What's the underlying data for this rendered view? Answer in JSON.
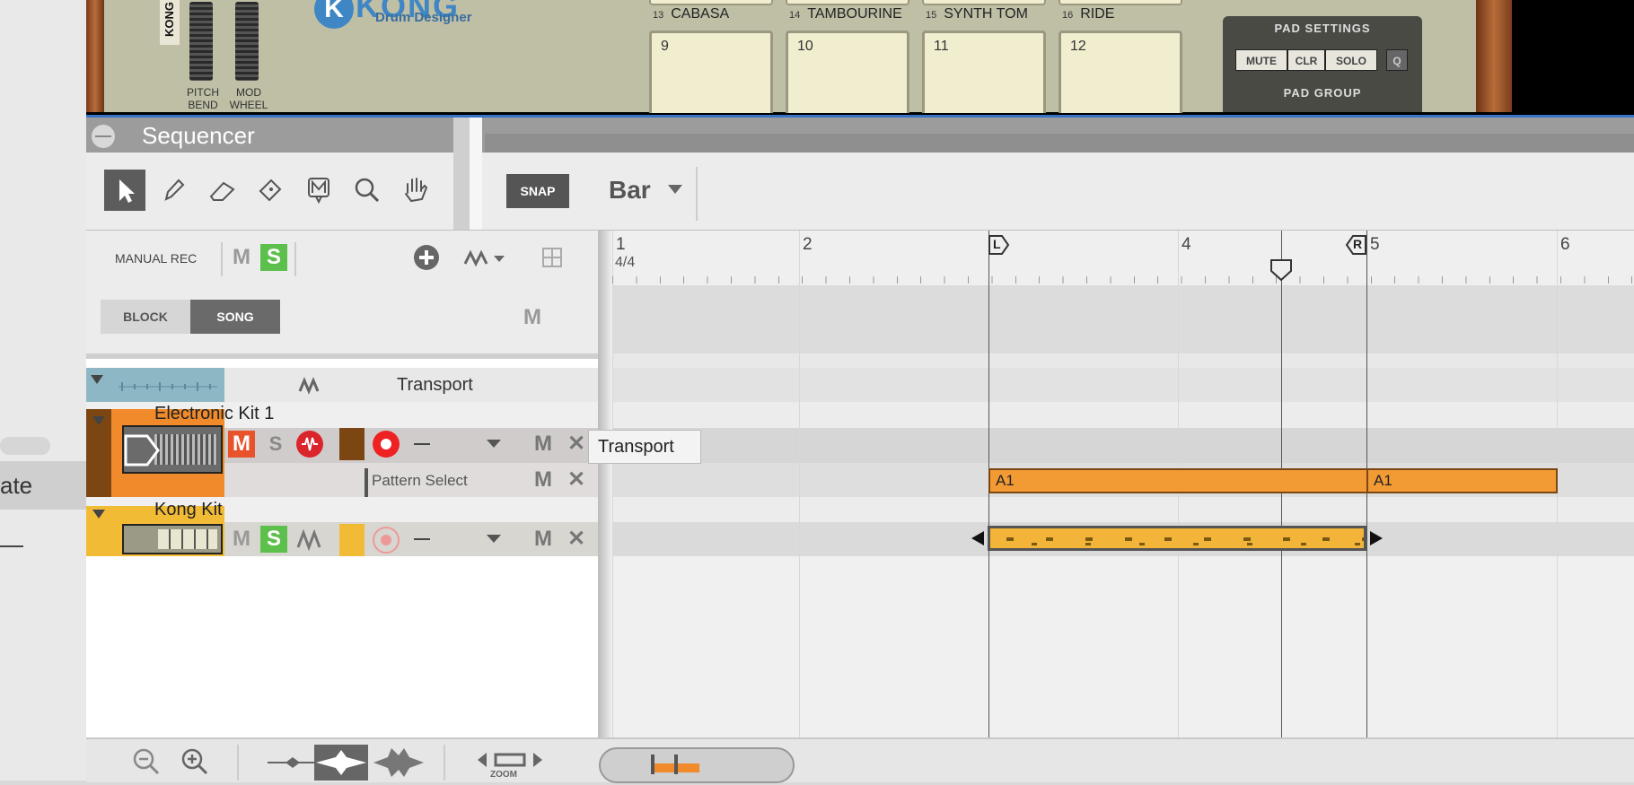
{
  "left_panel": {
    "selected_item_text": "ate"
  },
  "rack": {
    "device_brand": "KONG",
    "device_subtitle": "Drum Designer",
    "strip_label": "KONG",
    "wheels": [
      {
        "label_line1": "PITCH",
        "label_line2": "BEND"
      },
      {
        "label_line1": "MOD",
        "label_line2": "WHEEL"
      }
    ],
    "pad_names": [
      {
        "num": "13",
        "name": "CABASA"
      },
      {
        "num": "14",
        "name": "TAMBOURINE"
      },
      {
        "num": "15",
        "name": "SYNTH TOM"
      },
      {
        "num": "16",
        "name": "RIDE"
      }
    ],
    "pads": [
      "9",
      "10",
      "11",
      "12"
    ],
    "pad_settings": {
      "title": "PAD SETTINGS",
      "buttons": [
        "MUTE",
        "CLR",
        "SOLO",
        "Q"
      ],
      "group_title": "PAD GROUP"
    }
  },
  "sequencer": {
    "title": "Sequencer",
    "toolbar": {
      "tools": [
        "select-arrow",
        "pencil",
        "eraser",
        "razor",
        "mute",
        "magnifier",
        "hand"
      ],
      "snap_label": "SNAP",
      "snap_value": "Bar"
    },
    "header": {
      "manual_rec": "MANUAL REC",
      "m_label": "M",
      "s_label": "S",
      "block_label": "BLOCK",
      "song_label": "SONG"
    },
    "ruler": {
      "bars": [
        "1",
        "2",
        "3",
        "4",
        "5",
        "6"
      ],
      "time_signature": "4/4",
      "left_locator": "L",
      "right_locator": "R"
    },
    "tracks": {
      "transport": {
        "name": "Transport"
      },
      "electronic_kit": {
        "name": "Electronic Kit 1",
        "m_label": "M",
        "s_label": "S",
        "lane_mute": "M",
        "sublane": "Pattern Select",
        "clip_labels": [
          "A1",
          "A1"
        ]
      },
      "kong_kit": {
        "name": "Kong Kit",
        "m_label": "M",
        "s_label": "S",
        "lane_mute": "M"
      }
    },
    "tooltip": "Transport",
    "bottom": {
      "zoom_label": "ZOOM"
    }
  }
}
